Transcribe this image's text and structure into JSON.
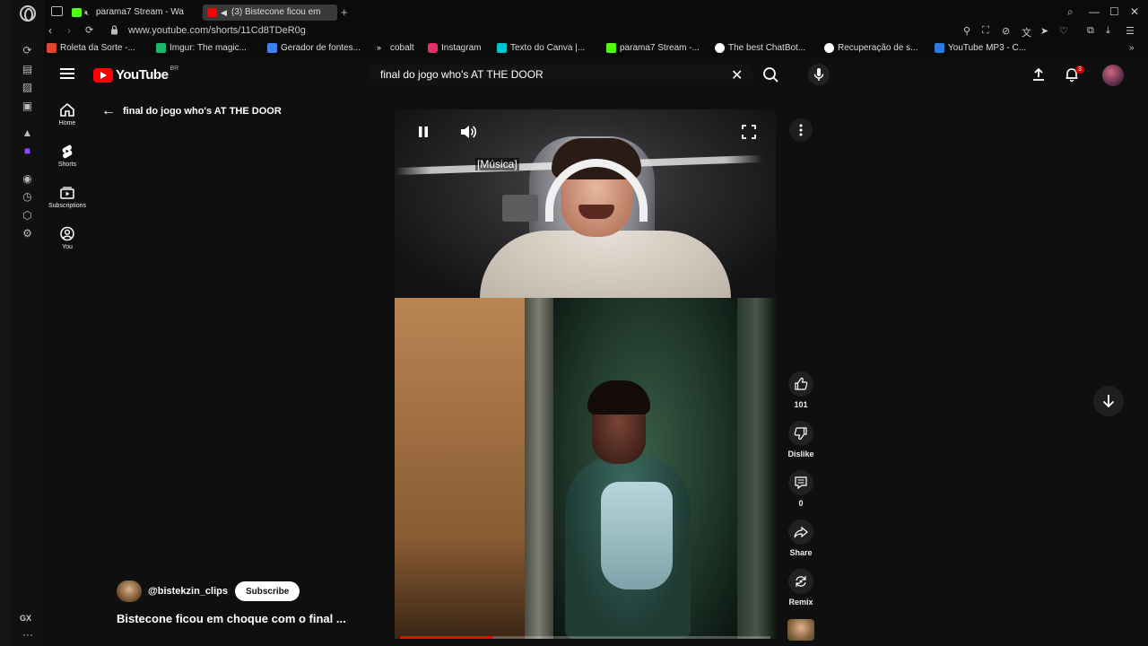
{
  "browser": {
    "tabs": [
      {
        "label": "parama7 Stream - Wa",
        "active": false,
        "favicon_color": "#53fc18"
      },
      {
        "label": "(3) Bistecone ficou em",
        "active": true,
        "favicon_color": "#ff0000"
      }
    ],
    "url": "www.youtube.com/shorts/11Cd8TDeR0g",
    "sidebar_label": "GX",
    "bookmarks": [
      {
        "label": "Roleta da Sorte -...",
        "color": "#e0452f"
      },
      {
        "label": "Imgur: The magic...",
        "color": "#1bb76e"
      },
      {
        "label": "Gerador de fontes...",
        "color": "#3d82f0"
      },
      {
        "label": "cobalt",
        "color": "#ffffff"
      },
      {
        "label": "Instagram",
        "color": "#e1306c"
      },
      {
        "label": "Texto do Canva |...",
        "color": "#00c4cc"
      },
      {
        "label": "parama7 Stream -...",
        "color": "#53fc18"
      },
      {
        "label": "The best ChatBot...",
        "color": "#ffffff"
      },
      {
        "label": "Recuperação de s...",
        "color": "#ffffff"
      },
      {
        "label": "YouTube MP3 - C...",
        "color": "#2d7ae0"
      }
    ]
  },
  "youtube": {
    "logo_text": "YouTube",
    "country_code": "BR",
    "search_value": "final do jogo who's AT THE DOOR",
    "notification_count": "3",
    "guide": [
      {
        "label": "Home",
        "icon": "home-icon"
      },
      {
        "label": "Shorts",
        "icon": "shorts-icon"
      },
      {
        "label": "Subscriptions",
        "icon": "subscriptions-icon"
      },
      {
        "label": "You",
        "icon": "you-icon"
      }
    ],
    "back_title": "final do jogo who's AT THE DOOR",
    "caption": "[Música]",
    "progress_fraction": 0.25,
    "actions": {
      "like_count": "101",
      "dislike_label": "Dislike",
      "comment_count": "0",
      "share_label": "Share",
      "remix_label": "Remix"
    },
    "channel_handle": "@bistekzin_clips",
    "subscribe_label": "Subscribe",
    "video_title": "Bistecone ficou em choque com o final ..."
  }
}
